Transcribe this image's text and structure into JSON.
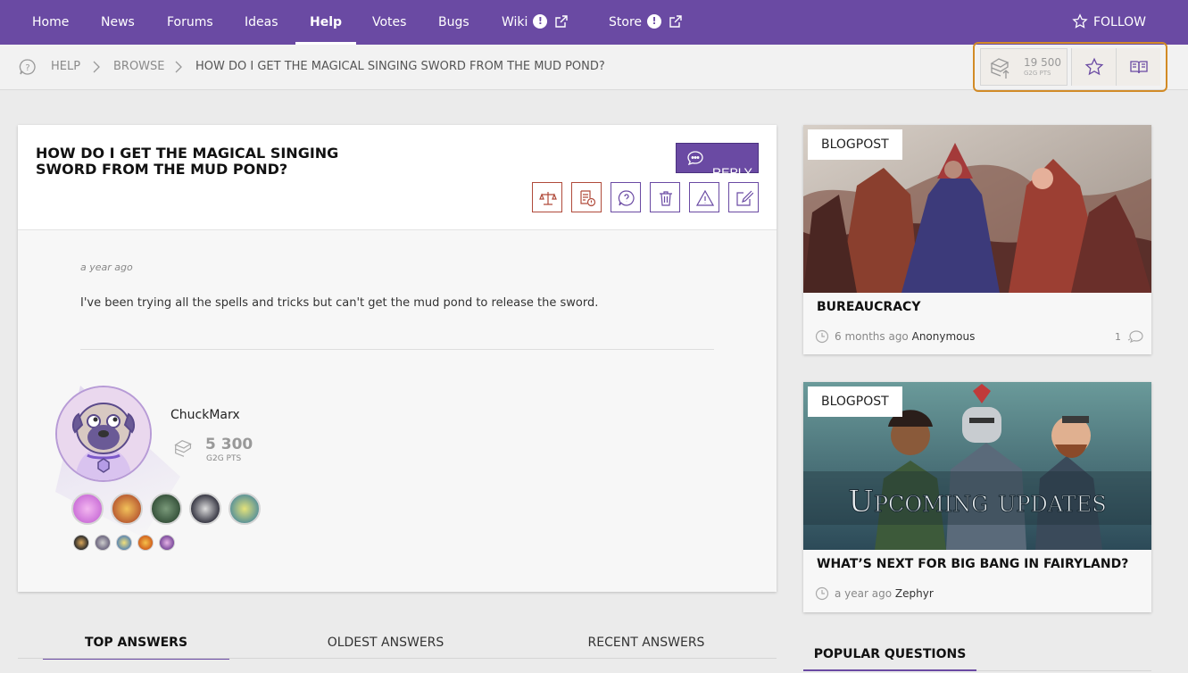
{
  "nav": {
    "items": [
      {
        "label": "Home"
      },
      {
        "label": "News"
      },
      {
        "label": "Forums"
      },
      {
        "label": "Ideas"
      },
      {
        "label": "Help"
      },
      {
        "label": "Votes"
      },
      {
        "label": "Bugs"
      },
      {
        "label": "Wiki"
      },
      {
        "label": "Store"
      }
    ],
    "active": "Help",
    "notice_mark": "!",
    "follow_label": "FOLLOW"
  },
  "breadcrumb": {
    "items": [
      "HELP",
      "BROWSE",
      "HOW DO I GET THE MAGICAL SINGING SWORD FROM THE MUD POND?"
    ]
  },
  "user_points": {
    "value": "19 500",
    "label": "G2G PTS"
  },
  "question": {
    "title": "HOW DO I GET THE MAGICAL SINGING SWORD FROM THE MUD POND?",
    "reply_label": "REPLY",
    "time": "a year ago",
    "body": "I've been trying all the spells and tricks but can't get the mud pond to release the sword.",
    "author": {
      "name": "ChuckMarx",
      "points": "5 300",
      "points_label": "G2G PTS"
    }
  },
  "tabs": [
    {
      "label": "TOP ANSWERS"
    },
    {
      "label": "OLDEST ANSWERS"
    },
    {
      "label": "RECENT ANSWERS"
    }
  ],
  "blogposts": [
    {
      "tag": "BLOGPOST",
      "title": "BUREAUCRACY",
      "time": "6 months ago",
      "author": "Anonymous",
      "comments": "1"
    },
    {
      "tag": "BLOGPOST",
      "title": "WHAT’S NEXT FOR BIG BANG IN FAIRYLAND?",
      "time": "a year ago",
      "author": "Zephyr",
      "image_text": "Upcoming updates"
    }
  ],
  "popular_questions_label": "POPULAR QUESTIONS",
  "colors": {
    "brand": "#6a4aa3",
    "highlight": "#d28b27",
    "tool_red": "#b04a3a"
  }
}
